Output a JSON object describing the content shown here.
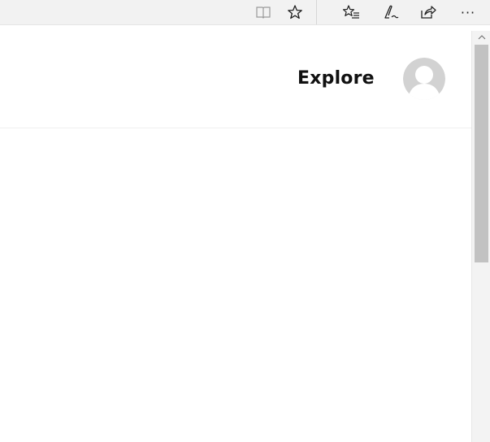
{
  "browser": {
    "toolbar_icons": [
      {
        "name": "reading-view-icon"
      },
      {
        "name": "favorite-star-icon"
      },
      {
        "name": "favorites-hub-icon"
      },
      {
        "name": "web-note-pen-icon"
      },
      {
        "name": "share-icon"
      },
      {
        "name": "more-dots-icon"
      }
    ],
    "more_label": "···"
  },
  "header": {
    "explore_label": "Explore",
    "avatar": "default-user-avatar"
  },
  "colors": {
    "toolbar_bg": "#f2f2f2",
    "scroll_thumb": "#c2c2c2",
    "avatar_bg": "#cfcfcf"
  }
}
